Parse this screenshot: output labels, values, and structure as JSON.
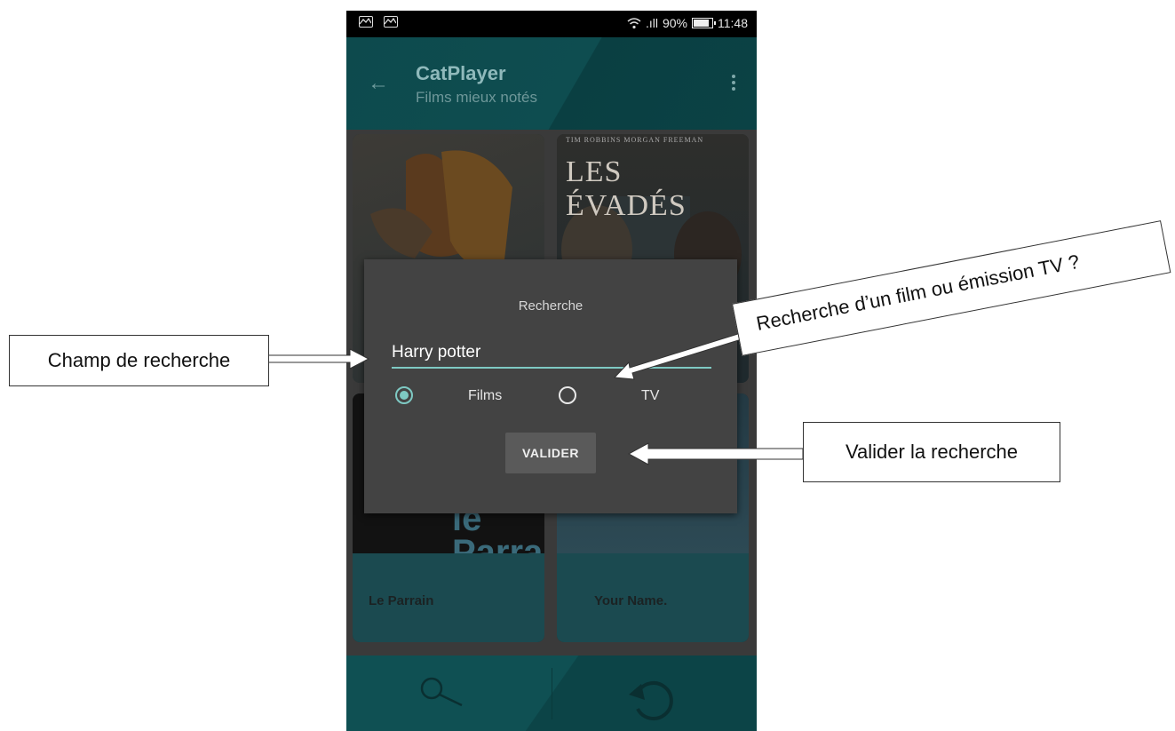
{
  "status_bar": {
    "signal_text": ".ıll",
    "battery_text": "90%",
    "battery_level": 0.9,
    "time": "11:48"
  },
  "app_bar": {
    "title": "CatPlayer",
    "subtitle": "Films mieux notés"
  },
  "grid": {
    "cards": [
      {
        "title": ""
      },
      {
        "title": "",
        "poster_credit": "TIM ROBBINS     MORGAN FREEMAN",
        "poster_title": "LES ÉVADÉS"
      },
      {
        "title": "Le Parrain",
        "poster_title": "le Parrain"
      },
      {
        "title": "Your Name."
      }
    ]
  },
  "dialog": {
    "title": "Recherche",
    "search_value": "Harry potter",
    "options": [
      {
        "label": "Films",
        "selected": true
      },
      {
        "label": "TV",
        "selected": false
      }
    ],
    "submit_label": "VALIDER"
  },
  "annotations": {
    "champ": "Champ de recherche",
    "recherche": "Recherche d’un film ou émission TV ?",
    "valider": "Valider la recherche"
  },
  "colors": {
    "accent": "#7ec9c3",
    "appbar": "#0d4a4d",
    "dialog": "#434343"
  }
}
